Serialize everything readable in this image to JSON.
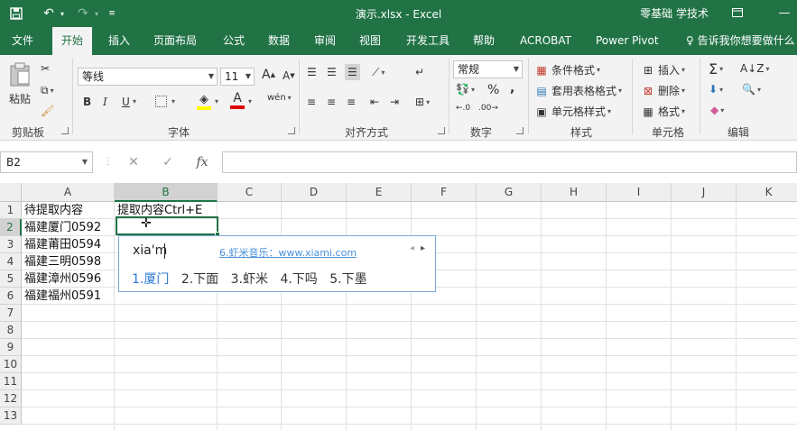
{
  "titlebar": {
    "title": "演示.xlsx  -  Excel",
    "user": "零基础 学技术",
    "save_icon": "save-icon",
    "undo_icon": "undo-icon",
    "redo_icon": "redo-icon",
    "customize_icon": "customize-quick-access-icon"
  },
  "tabs": {
    "file": "文件",
    "home": "开始",
    "insert": "插入",
    "layout": "页面布局",
    "formulas": "公式",
    "data": "数据",
    "review": "审阅",
    "view": "视图",
    "developer": "开发工具",
    "help": "帮助",
    "acrobat": "ACROBAT",
    "powerpivot": "Power Pivot",
    "tell_me": "告诉我你想要做什么"
  },
  "ribbon": {
    "clipboard": {
      "paste": "粘贴",
      "label": "剪贴板"
    },
    "font": {
      "name": "等线",
      "size": "11",
      "bold": "B",
      "italic": "I",
      "underline": "U",
      "label": "字体",
      "grow": "A",
      "shrink": "A",
      "phonetic": "wén"
    },
    "alignment": {
      "label": "对齐方式"
    },
    "number": {
      "format": "常规",
      "percent": "%",
      "comma": ",",
      "label": "数字"
    },
    "styles": {
      "conditional": "条件格式",
      "table": "套用表格格式",
      "cell": "单元格样式",
      "label": "样式"
    },
    "cells": {
      "insert": "插入",
      "delete": "删除",
      "format": "格式",
      "label": "单元格"
    },
    "editing": {
      "label": "编辑",
      "sum": "Σ"
    }
  },
  "formula_bar": {
    "name_box": "B2",
    "cancel": "✕",
    "enter": "✓",
    "fx": "fx",
    "content": ""
  },
  "grid": {
    "columns": [
      "A",
      "B",
      "C",
      "D",
      "E",
      "F",
      "G",
      "H",
      "I",
      "J",
      "K"
    ],
    "rows": [
      "1",
      "2",
      "3",
      "4",
      "5",
      "6",
      "7",
      "8",
      "9",
      "10",
      "11",
      "12",
      "13"
    ],
    "cells": {
      "A1": "待提取内容",
      "B1": "提取内容Ctrl+E",
      "A2": "福建厦门0592",
      "A3": "福建莆田0594",
      "A4": "福建三明0598",
      "A5": "福建漳州0596",
      "A6": "福建福州0591"
    }
  },
  "ime": {
    "composition": "xia'm",
    "ad": "6.虾米音乐：www.xiami.com",
    "prev": "◂",
    "next": "▸",
    "candidates": [
      "1.厦门",
      "2.下面",
      "3.虾米",
      "4.下吗",
      "5.下墨"
    ]
  }
}
